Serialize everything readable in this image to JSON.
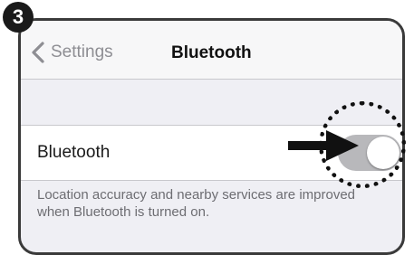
{
  "step": {
    "number": "3"
  },
  "nav": {
    "back_label": "Settings",
    "title": "Bluetooth"
  },
  "bluetooth_row": {
    "label": "Bluetooth",
    "toggle_state": "off"
  },
  "footer": {
    "note": "Location accuracy and nearby services are improved when Bluetooth is turned on."
  },
  "icons": {
    "back": "chevron-left-icon",
    "arrow": "arrow-right-icon"
  },
  "colors": {
    "toggle_off": "#b8b8bb",
    "nav_text": "#8e8e93",
    "background": "#efeff4"
  }
}
